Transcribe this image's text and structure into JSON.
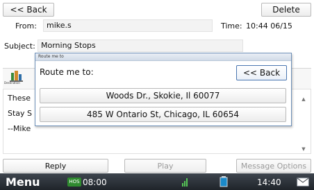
{
  "header": {
    "back_label": "<< Back",
    "delete_label": "Delete"
  },
  "message": {
    "from_label": "From:",
    "from_value": "mike.s",
    "time_label": "Time:",
    "time_value": "10:44 06/15",
    "subject_label": "Subject:",
    "subject_value": "Morning Stops",
    "body_lines": [
      "These",
      "Stay S",
      "--Mike"
    ]
  },
  "toolbar": {
    "destination_label": "Destination"
  },
  "dialog": {
    "title": "Route me to",
    "prompt": "Route me to:",
    "back_label": "<< Back",
    "options": [
      "Woods Dr., Skokie, Il 60077",
      "485 W Ontario St, Chicago, IL 60654"
    ]
  },
  "actions": {
    "reply": "Reply",
    "play": "Play",
    "message_options": "Message Options"
  },
  "statusbar": {
    "menu": "Menu",
    "hos_badge": "HOS",
    "hos_time": "08:00",
    "clock": "14:40"
  },
  "colors": {
    "accent": "#4a76b0",
    "statusbar": "#2a3038",
    "hos_green": "#2f8a2f"
  }
}
